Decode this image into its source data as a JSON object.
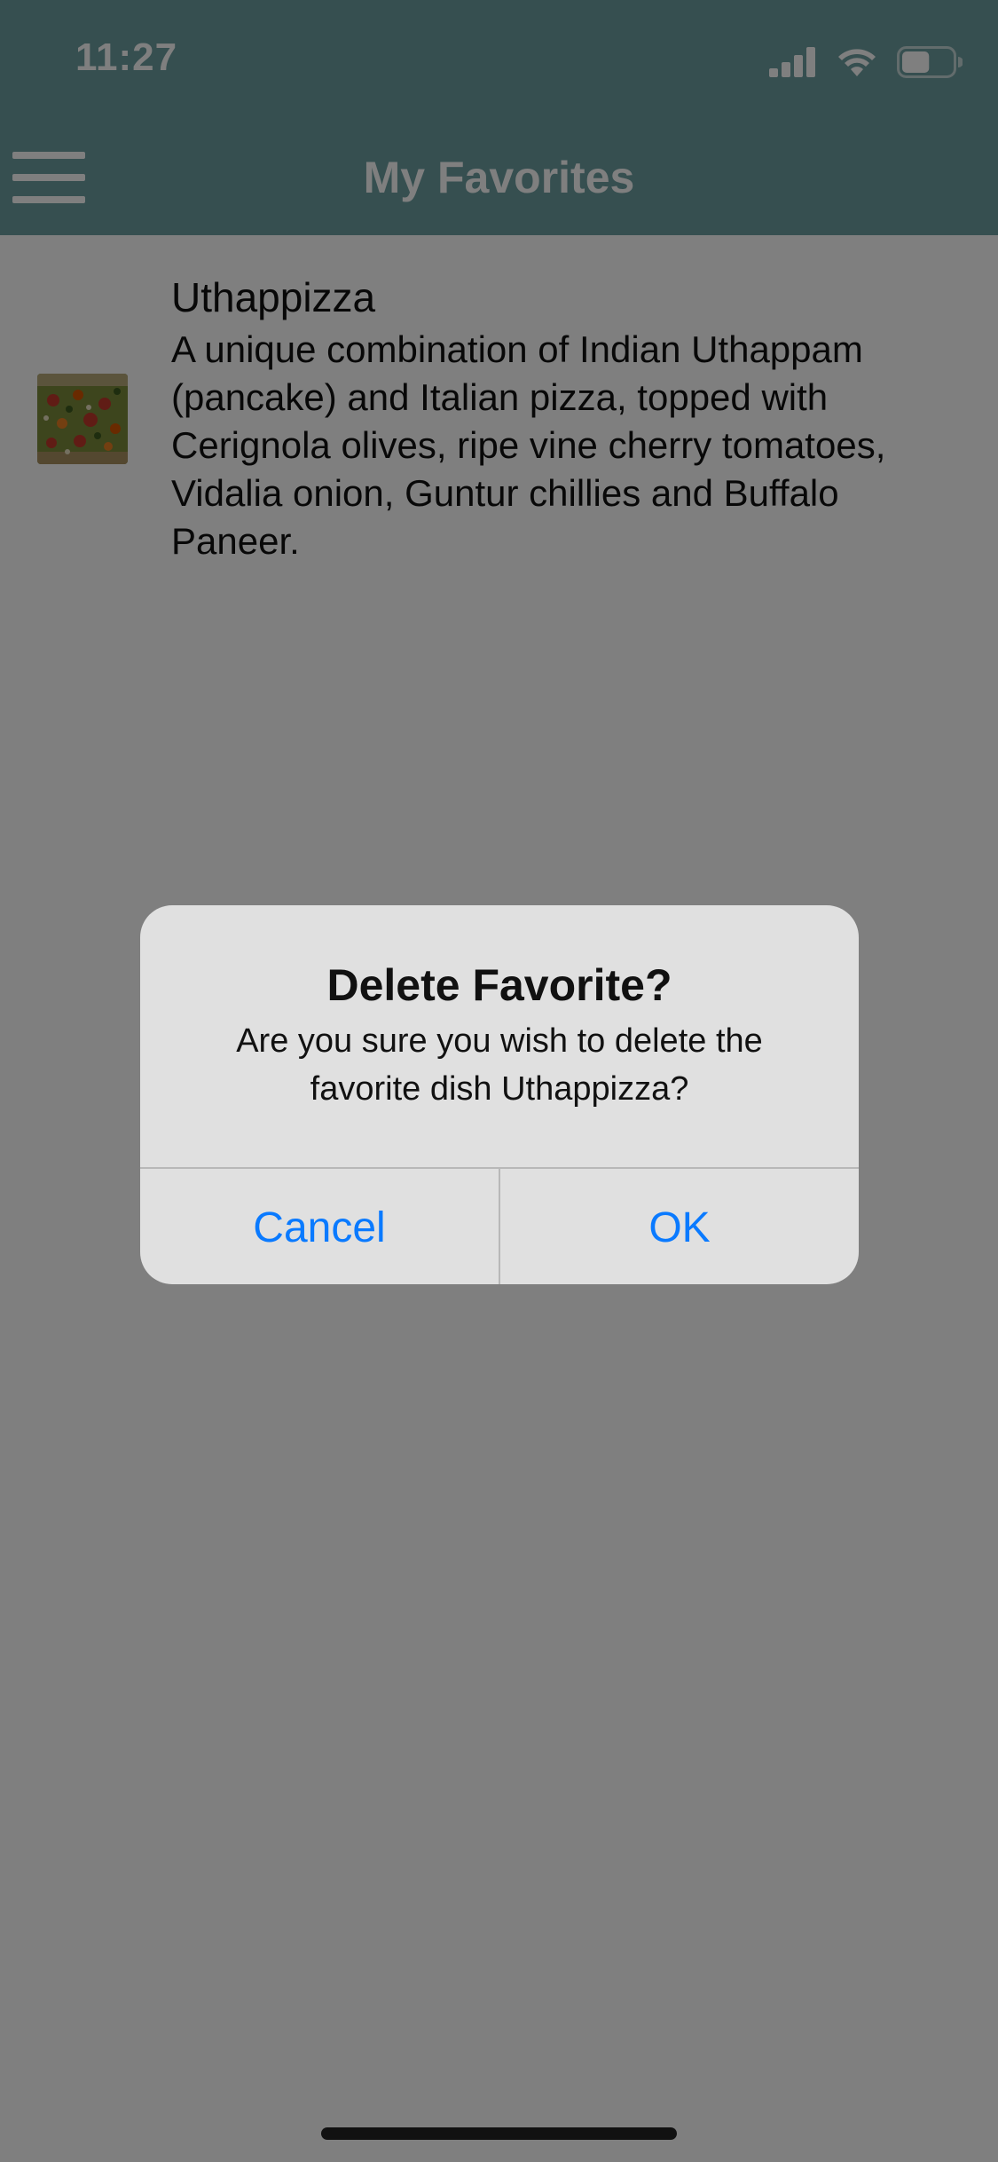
{
  "status_bar": {
    "time": "11:27",
    "icons": [
      "cellular-signal-icon",
      "wifi-icon",
      "battery-icon"
    ],
    "battery_level": 0.55
  },
  "nav": {
    "title": "My Favorites",
    "menu_icon": "hamburger-menu-icon"
  },
  "favorites": [
    {
      "title": "Uthappizza",
      "description": "A unique combination of Indian Uthappam (pancake) and Italian pizza, topped with Cerignola olives, ripe vine cherry tomatoes, Vidalia onion, Guntur chillies and Buffalo Paneer.",
      "thumbnail": "pizza-image"
    }
  ],
  "alert": {
    "title": "Delete Favorite?",
    "message": "Are you sure you wish to delete the favorite dish Uthappizza?",
    "cancel_label": "Cancel",
    "ok_label": "OK"
  },
  "colors": {
    "header": "#6c9ea0",
    "alert_background": "#e0e0e0",
    "action_blue": "#0a7aff",
    "overlay": "rgba(0,0,0,0.5)"
  }
}
